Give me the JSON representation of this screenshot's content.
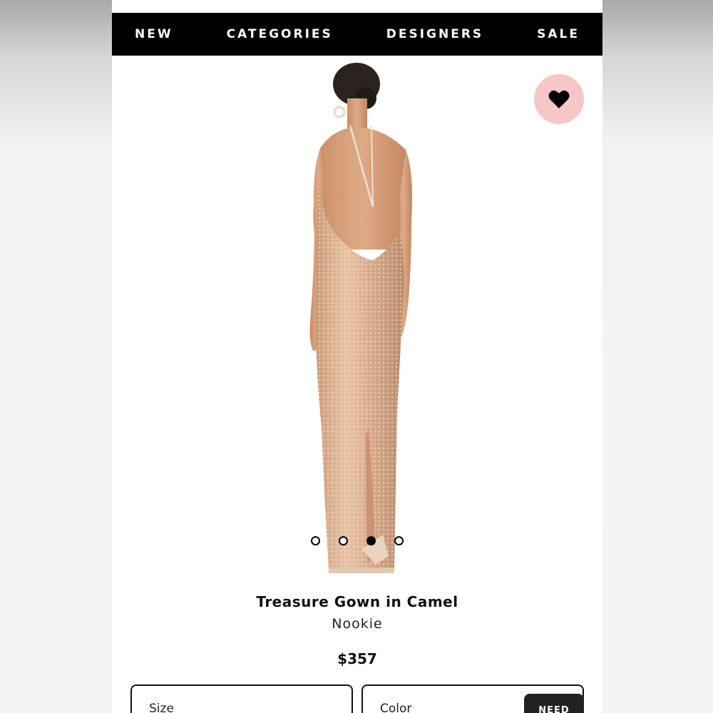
{
  "nav": {
    "items": [
      "NEW",
      "CATEGORIES",
      "DESIGNERS",
      "SALE"
    ]
  },
  "product": {
    "title": "Treasure Gown in Camel",
    "designer": "Nookie",
    "price": "$357",
    "image_icon": "product-photo",
    "carousel": {
      "count": 4,
      "active_index": 2
    }
  },
  "favorite": {
    "icon": "heart-icon",
    "bg_color": "#f7c6c6"
  },
  "options": {
    "size_label": "Size",
    "color_label": "Color",
    "help_button_label": "NEED"
  },
  "colors": {
    "nav_bg": "#000000",
    "nav_text": "#ffffff",
    "dress": "#d9ad8e"
  }
}
